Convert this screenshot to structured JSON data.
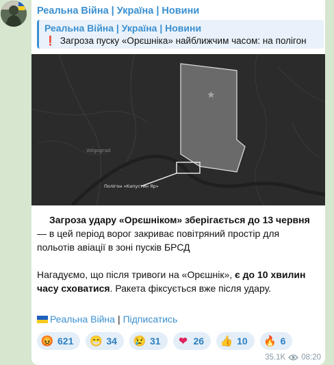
{
  "channel": {
    "name": "Реальна Війна | Україна | Новини"
  },
  "reply": {
    "title": "Реальна Війна | Україна | Новини",
    "text": "Загроза пуску «Орєшніка» найближчим часом: на полігон"
  },
  "map": {
    "city_label": "Volgograd",
    "polygon_label": "Полігон «Капустин Яр»"
  },
  "message": {
    "p1_bold": "Загроза удару «Орєшніком» зберігається до 13 червня",
    "p1_rest": " — в цей період ворог закриває повітряний простір для польотів авіації в зоні пусків БРСД",
    "p2_start": "Нагадуємо, що після тривоги на «Орєшнік»",
    "p2_comma": ", ",
    "p2_bold": "є до 10 хвилин часу сховатися",
    "p2_end": ". Ракета фіксується вже після удару."
  },
  "footer": {
    "channel_link": "Реальна Війна",
    "separator": "|",
    "subscribe_link": "Підписатись"
  },
  "reactions": [
    {
      "icon": "angry-face-icon",
      "glyph": "😡",
      "count": "621"
    },
    {
      "icon": "grinning-face-icon",
      "glyph": "😁",
      "count": "34"
    },
    {
      "icon": "crying-face-icon",
      "glyph": "😢",
      "count": "31"
    },
    {
      "icon": "heart-icon",
      "glyph": "❤",
      "count": "26"
    },
    {
      "icon": "thumbs-up-icon",
      "glyph": "👍",
      "count": "10"
    },
    {
      "icon": "fire-icon",
      "glyph": "🔥",
      "count": "6"
    }
  ],
  "meta": {
    "views": "35.1K",
    "time": "08:20"
  },
  "colors": {
    "accent": "#3a8fd0",
    "flag_blue": "#1f5fbf",
    "flag_yellow": "#f5cc1d",
    "alert_red": "#d12424"
  }
}
